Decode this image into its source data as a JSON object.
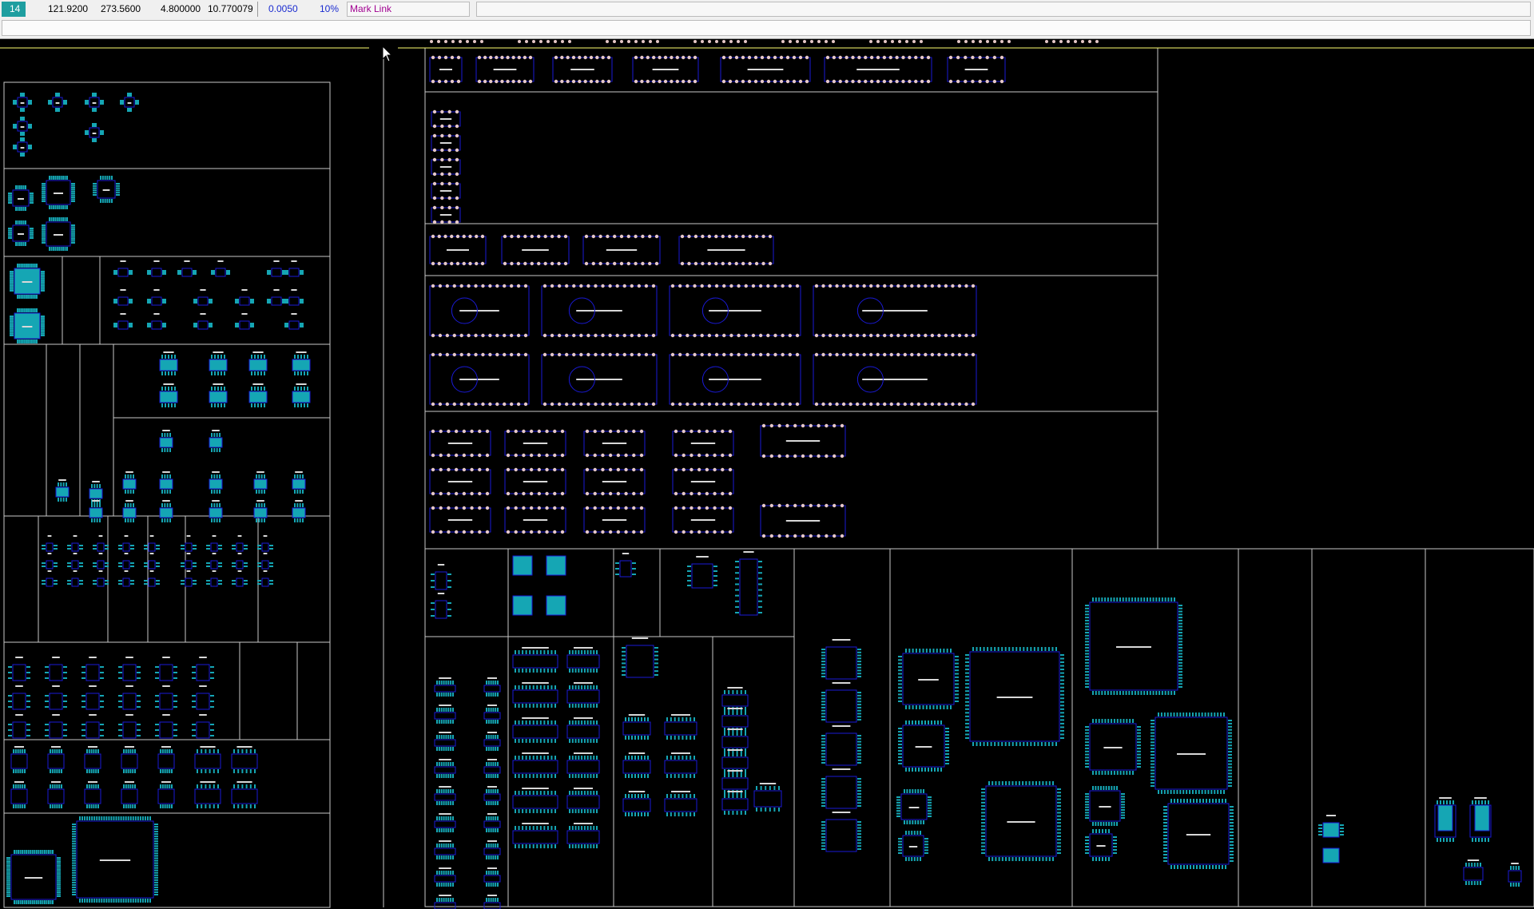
{
  "status": {
    "layer": "14",
    "x": "121.9200",
    "y": "273.5600",
    "width": "4.800000",
    "length": "10.770079",
    "grid": "0.0050",
    "zoom": "10%",
    "mode": "Mark Link"
  },
  "colors": {
    "background": "#000000",
    "outline": "#1a1ad6",
    "pad": "#15a6b4",
    "silk": "#d8d8d8",
    "thru_pad": "#e6c8c8",
    "frame": "#c8c8c8",
    "cursor_line": "#ffff70"
  },
  "cursor": "arrow-pointer-icon"
}
